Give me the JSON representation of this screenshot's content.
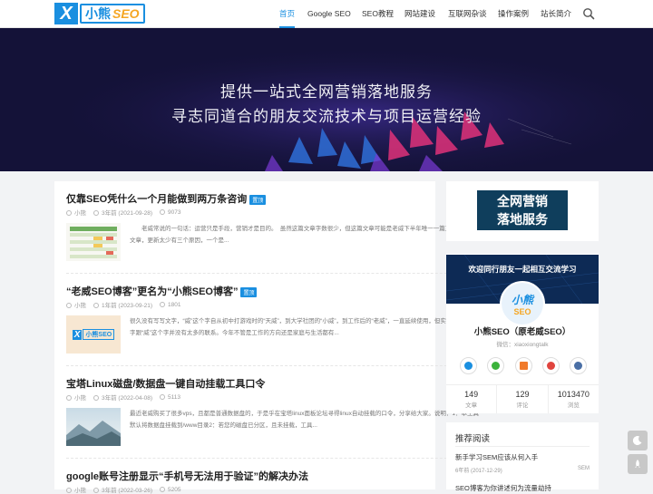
{
  "header": {
    "logo_x": "X",
    "logo_main": "小熊",
    "logo_seo": "SEO",
    "nav": [
      "首页",
      "Google SEO",
      "SEO教程",
      "网站建设",
      "互联网杂谈",
      "操作案例",
      "站长简介"
    ],
    "active_index": 0
  },
  "banner": {
    "line1": "提供一站式全网营销落地服务",
    "line2": "寻志同道合的朋友交流技术与项目运营经验"
  },
  "posts": [
    {
      "title": "仅靠SEO凭什么一个月能做到两万条咨询",
      "tag": "置顶",
      "author": "小熊",
      "time": "3年前 (2021-09-28)",
      "views": "9073",
      "excerpt": "老威常说的一句话：运营只是手段，营销才是目的。　虽然这篇文章字数很少，但这篇文章可能是老威下半年唯一一篇正儿八经的文章，更新太少有三个原因，一个是..."
    },
    {
      "title": "“老威SEO博客”更名为“小熊SEO博客”",
      "tag": "置顶",
      "author": "小熊",
      "time": "1年前 (2023-09-21)",
      "views": "1801",
      "excerpt": "很久没有写写文字，“威”这个字自从初中打游戏时的“天威”，到大学社团的“小威”，到工作后的“老威”，一直延续使用，但实际上我的名字跟“威”这个字并没有太多的联系。今年不管是工作的方向还是家庭与生活都有..."
    },
    {
      "title": "宝塔Linux磁盘/数据盘一键自动挂载工具口令",
      "tag": "",
      "author": "小熊",
      "time": "3年前 (2022-04-08)",
      "views": "5113",
      "excerpt": "最近老威购买了很多vps，且都是普通数据盘的，于是乎在宝塔linux面板论坛寻得linux自动挂载的口令，分享给大家。说明：1：本工具默认将数据盘挂载到/www目录2：若您的磁盘已分区，且未挂载，工具..."
    },
    {
      "title": "google账号注册显示“手机号无法用于验证”的解决办法",
      "tag": "",
      "author": "小熊",
      "time": "3年前 (2022-03-26)",
      "views": "5205",
      "excerpt": ""
    }
  ],
  "thumb2": {
    "x": "X",
    "text": "小熊SEO"
  },
  "sidebar": {
    "ad_line1": "全网营销",
    "ad_line2": "落地服务",
    "slogan": "欢迎同行朋友一起相互交流学习",
    "avatar_top": "小熊",
    "avatar_bottom": "SEO",
    "name": "小熊SEO（原老威SEO）",
    "wechat": "微信：xiaoxiongtalk",
    "social_icons": [
      "qq-icon",
      "wechat-icon",
      "email-icon",
      "weibo-icon",
      "user-icon"
    ],
    "social_colors": [
      "#1a8fe0",
      "#3bb33b",
      "#f07a2a",
      "#e0443e",
      "#4a6fa5"
    ],
    "stats": [
      {
        "value": "149",
        "label": "文章"
      },
      {
        "value": "129",
        "label": "评论"
      },
      {
        "value": "1013470",
        "label": "浏览"
      }
    ],
    "rec_title": "推荐阅读",
    "recommend": [
      {
        "title": "新手学习SEM应该从何入手",
        "time": "6年前 (2017-12-29)",
        "cat": "SEM"
      },
      {
        "title": "SEO博客为你讲述何为流量劫持",
        "time": "",
        "cat": ""
      }
    ]
  }
}
